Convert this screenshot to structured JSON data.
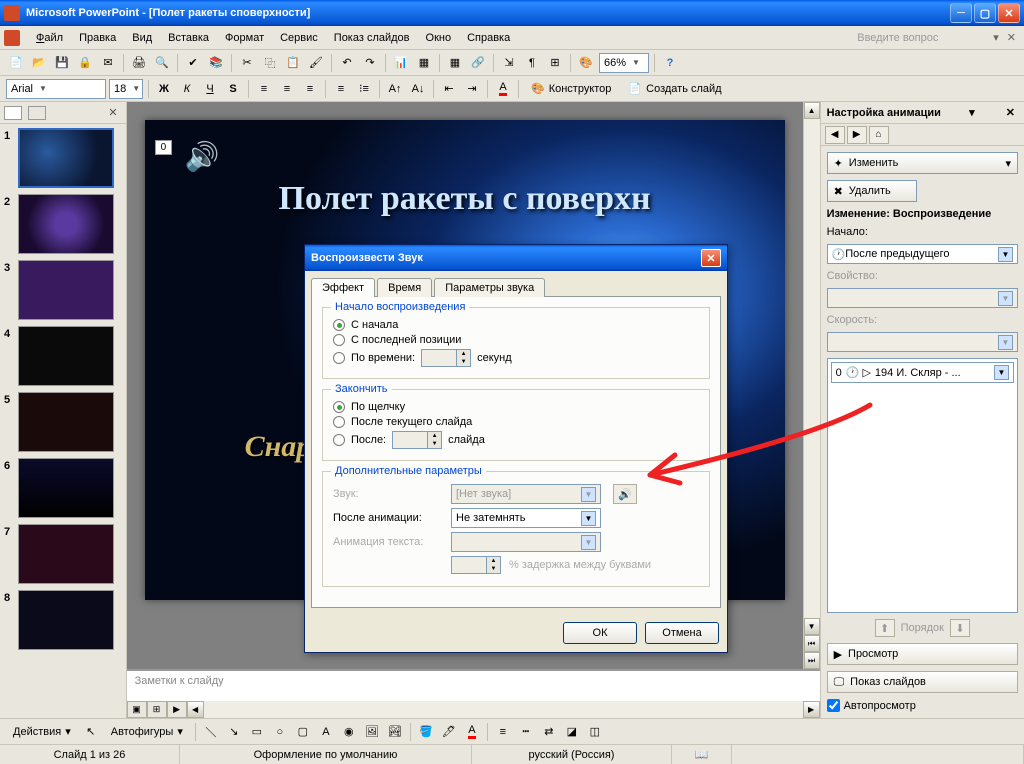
{
  "titlebar": {
    "app": "Microsoft PowerPoint",
    "doc": "[Полет ракеты споверхности]"
  },
  "menu": {
    "file": "Файл",
    "edit": "Правка",
    "view": "Вид",
    "insert": "Вставка",
    "format": "Формат",
    "tools": "Сервис",
    "slideshow": "Показ слайдов",
    "window": "Окно",
    "help": "Справка",
    "ask": "Введите вопрос"
  },
  "toolbar": {
    "zoom": "66%",
    "font": "Arial",
    "size": "18",
    "designer": "Конструктор",
    "new_slide": "Создать слайд"
  },
  "slides": {
    "numbers": [
      "1",
      "2",
      "3",
      "4",
      "5",
      "6",
      "7",
      "8"
    ]
  },
  "canvas": {
    "placeholder_num": "0",
    "title": "Полет ракеты с поверхн",
    "subtitle": "Снар"
  },
  "notes": {
    "placeholder": "Заметки к слайду"
  },
  "taskpane": {
    "title": "Настройка анимации",
    "change": "Изменить",
    "delete": "Удалить",
    "change_label": "Изменение: Воспроизведение",
    "start_label": "Начало:",
    "start_value": "После предыдущего",
    "property_label": "Свойство:",
    "speed_label": "Скорость:",
    "anim_num": "0",
    "anim_text": "194 И. Скляр - ...",
    "order": "Порядок",
    "preview": "Просмотр",
    "slideshow": "Показ слайдов",
    "autopreview": "Автопросмотр"
  },
  "dialog": {
    "title": "Воспроизвести Звук",
    "tab_effect": "Эффект",
    "tab_time": "Время",
    "tab_sound": "Параметры звука",
    "start_group": "Начало воспроизведения",
    "from_start": "С начала",
    "from_last": "С последней позиции",
    "by_time": "По времени:",
    "seconds": "секунд",
    "end_group": "Закончить",
    "on_click": "По щелчку",
    "after_current": "После текущего слайда",
    "after": "После:",
    "slides": "слайда",
    "extra_group": "Дополнительные параметры",
    "sound_label": "Звук:",
    "sound_value": "[Нет звука]",
    "after_anim_label": "После анимации:",
    "after_anim_value": "Не затемнять",
    "text_anim_label": "Анимация текста:",
    "delay_label": "% задержка между буквами",
    "ok": "ОК",
    "cancel": "Отмена"
  },
  "drawbar": {
    "actions": "Действия",
    "autoshapes": "Автофигуры"
  },
  "status": {
    "slide": "Слайд 1 из 26",
    "design": "Оформление по умолчанию",
    "lang": "русский (Россия)"
  }
}
